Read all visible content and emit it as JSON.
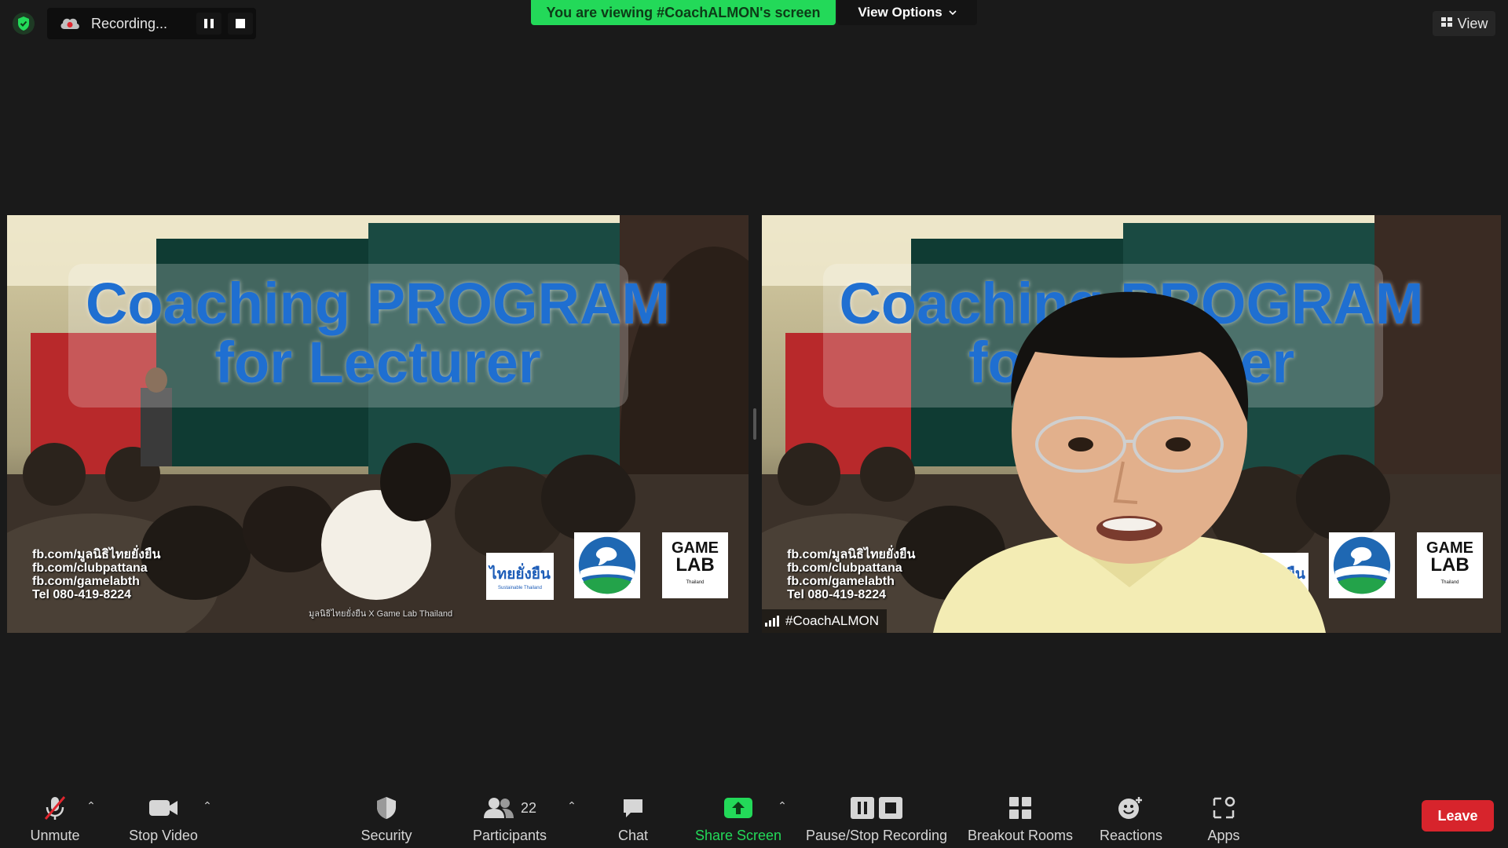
{
  "recording": {
    "label": "Recording...",
    "pause_icon": "pause-icon",
    "stop_icon": "stop-icon"
  },
  "banner": {
    "viewing_text": "You are viewing #CoachALMON's screen",
    "view_options_label": "View Options"
  },
  "view_button": {
    "label": "View"
  },
  "slide": {
    "title_line1": "Coaching PROGRAM",
    "title_line2": "for Lecturer",
    "contact_lines": [
      "fb.com/มูลนิธิไทยยั่งยืน",
      "fb.com/clubpattana",
      "fb.com/gamelabth",
      "Tel 080-419-8224"
    ],
    "credit": "มูลนิธิไทยยั่งยืน X Game Lab Thailand",
    "logo_thai_text": "ไทยยั่งยืน",
    "logo_thai_sub": "Sustainable Thailand",
    "logo_game_line1": "GAME",
    "logo_game_line2": "LAB",
    "logo_game_sub": "Thailand"
  },
  "participant_tile": {
    "name": "#CoachALMON"
  },
  "colors": {
    "accent_green": "#23d959",
    "leave_red": "#d7242c",
    "title_blue": "#1f6fd1"
  },
  "toolbar": {
    "unmute_label": "Unmute",
    "stop_video_label": "Stop Video",
    "security_label": "Security",
    "participants_label": "Participants",
    "participants_count": "22",
    "chat_label": "Chat",
    "share_screen_label": "Share Screen",
    "pause_stop_label": "Pause/Stop Recording",
    "breakout_label": "Breakout Rooms",
    "reactions_label": "Reactions",
    "apps_label": "Apps",
    "leave_label": "Leave"
  }
}
